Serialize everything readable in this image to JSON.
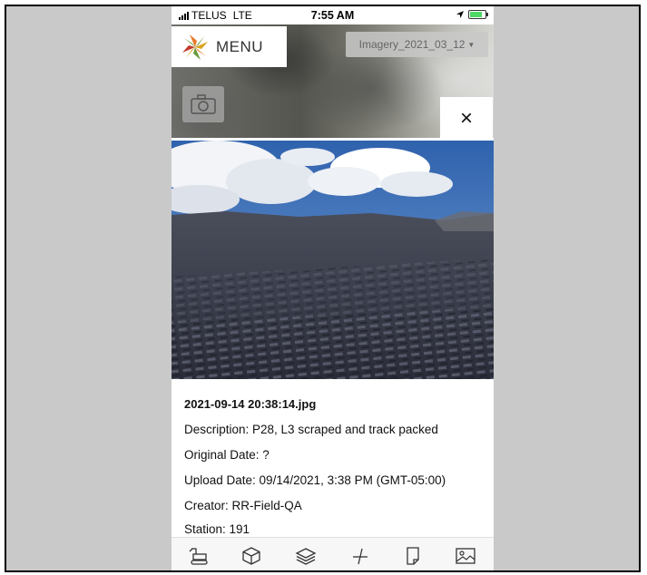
{
  "status_bar": {
    "carrier": "TELUS",
    "network": "LTE",
    "time": "7:55 AM"
  },
  "header": {
    "menu_label": "MENU",
    "imagery_select": "Imagery_2021_03_12",
    "close_label": "×"
  },
  "photo_info": {
    "filename": "2021-09-14 20:38:14.jpg",
    "description": "Description: P28, L3 scraped and track packed",
    "original_date": "Original Date: ?",
    "upload_date": "Upload Date: 09/14/2021, 3:38 PM (GMT-05:00)",
    "creator": "Creator: RR-Field-QA",
    "station": "Station: 191"
  },
  "toolbar": {
    "icons": [
      "excavator-icon",
      "cube-icon",
      "layers-icon",
      "measure-icon",
      "document-icon",
      "image-icon"
    ]
  },
  "colors": {
    "logo_orange": "#e8792b",
    "logo_green": "#6a9a3a",
    "logo_gold": "#d9a520",
    "sky": "#3c6fb4"
  }
}
